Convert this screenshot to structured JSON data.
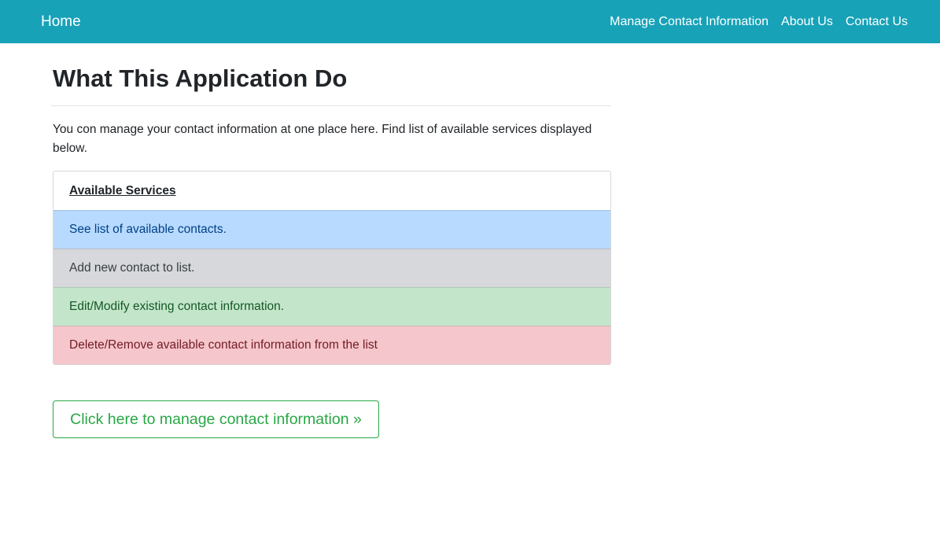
{
  "navbar": {
    "brand": "Home",
    "links": [
      {
        "label": "Manage Contact Information"
      },
      {
        "label": "About Us"
      },
      {
        "label": "Contact Us"
      }
    ],
    "background_color": "#17a2b8"
  },
  "main": {
    "title": "What This Application Do",
    "intro": "You con manage your contact information at one place here. Find list of available services displayed below.",
    "services": {
      "header": "Available Services",
      "items": [
        {
          "label": "See list of available contacts.",
          "variant": "primary",
          "color": "#b8daff"
        },
        {
          "label": "Add new contact to list.",
          "variant": "secondary",
          "color": "#d6d8db"
        },
        {
          "label": "Edit/Modify existing contact information.",
          "variant": "success",
          "color": "#c3e6cb"
        },
        {
          "label": "Delete/Remove available contact information from the list",
          "variant": "danger",
          "color": "#f5c6cb"
        }
      ]
    },
    "cta_label": "Click here to manage contact information »",
    "cta_color": "#28a745"
  }
}
